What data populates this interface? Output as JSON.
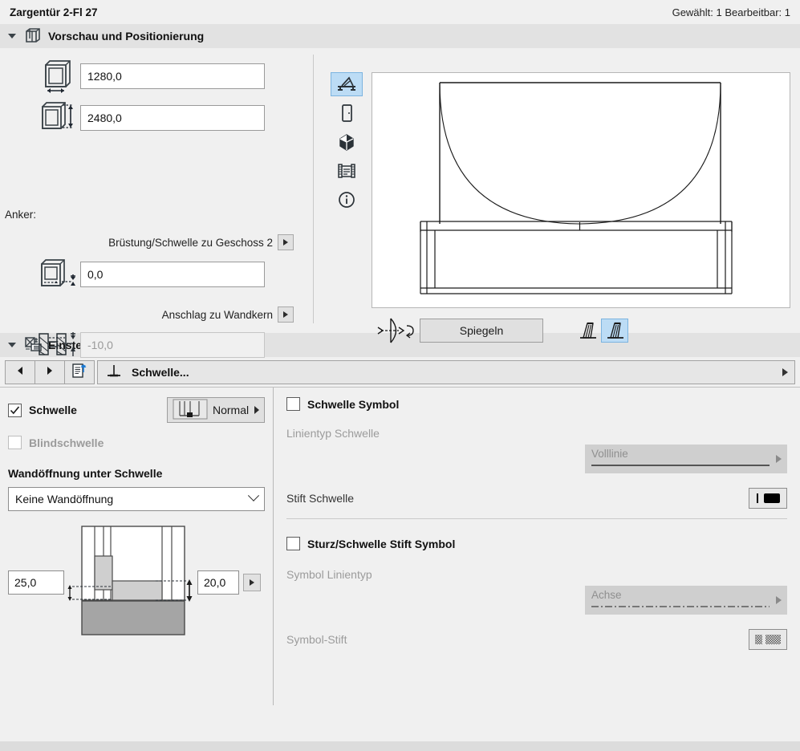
{
  "titlebar": {
    "title": "Zargentür 2-Fl 27",
    "status": "Gewählt: 1 Bearbeitbar: 1"
  },
  "preview_section": {
    "header": "Vorschau und Positionierung",
    "header_icon": "book-shelf-icon",
    "width_field": {
      "value": "1280,0",
      "icon": "door-width-icon"
    },
    "height_field": {
      "value": "2480,0",
      "icon": "door-height-icon"
    },
    "anker_label": "Anker:",
    "sill_label": "Brüstung/Schwelle zu Geschoss 2",
    "sill_value": "0,0",
    "reveal_label": "Anschlag zu Wandkern",
    "reveal_value": "-10,0",
    "anchor_toggles": [
      {
        "name": "anchor-top-left",
        "selected": false
      },
      {
        "name": "anchor-top-right",
        "selected": false
      },
      {
        "name": "anchor-center-left",
        "selected": true
      },
      {
        "name": "anchor-center-right",
        "selected": true
      },
      {
        "name": "anchor-bottom",
        "selected": false
      },
      {
        "name": "anchor-flip",
        "selected": false
      }
    ],
    "view_tools": [
      {
        "name": "elevation-view-icon",
        "selected": true
      },
      {
        "name": "door-2d-view-icon",
        "selected": false
      },
      {
        "name": "3d-view-icon",
        "selected": false
      },
      {
        "name": "section-view-icon",
        "selected": false
      },
      {
        "name": "info-view-icon",
        "selected": false
      }
    ],
    "mirror_button": "Spiegeln",
    "flip_icon": "flip-horizontal-icon",
    "side_toggles": [
      {
        "name": "opening-side-left-icon",
        "selected": false
      },
      {
        "name": "opening-side-right-icon",
        "selected": true
      }
    ]
  },
  "settings_section": {
    "header": "Einstellungen Innentür",
    "header_icon": "settings-door-icon",
    "toolbar": {
      "prev_icon": "arrow-left-icon",
      "next_icon": "arrow-right-icon",
      "extract_icon": "document-export-icon",
      "page_icon": "threshold-icon",
      "page_label": "Schwelle...",
      "overflow_icon": "arrow-right-icon"
    },
    "left": {
      "threshold_checkbox": {
        "label": "Schwelle",
        "checked": true
      },
      "threshold_type_button": {
        "label": "Normal",
        "icon": "threshold-profile-icon"
      },
      "blind_checkbox": {
        "label": "Blindschwelle",
        "checked": false
      },
      "wall_opening_title": "Wandöffnung unter Schwelle",
      "wall_opening_value": "Keine Wandöffnung",
      "left_dim_value": "25,0",
      "right_dim_value": "20,0",
      "diagram_name": "wall-opening-diagram"
    },
    "right": {
      "threshold_symbol_checkbox": {
        "label": "Schwelle Symbol",
        "checked": false
      },
      "line_type_label": "Linientyp Schwelle",
      "line_type_value": "Volllinie",
      "pen_label": "Stift Schwelle",
      "pen_swatch_color": "#000000",
      "symbol_pen_checkbox": {
        "label": "Sturz/Schwelle Stift Symbol",
        "checked": false
      },
      "symbol_line_type_label": "Symbol Linientyp",
      "symbol_line_type_value": "Achse",
      "symbol_pen_label": "Symbol-Stift",
      "symbol_pen_swatch_color": "#6f6f6f"
    }
  },
  "colors": {
    "accent_selected": "#bcdcf5",
    "panel_bg": "#f0f0f0",
    "header_bg": "#e2e2e2"
  }
}
